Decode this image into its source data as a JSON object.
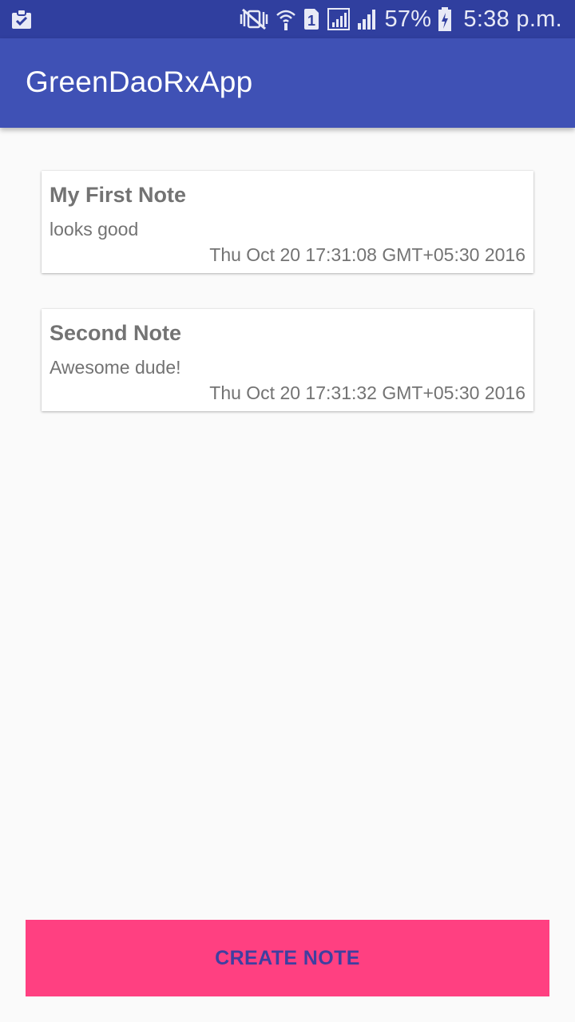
{
  "status_bar": {
    "left_icon": "clipboard-check-icon",
    "icons": [
      "mute-vibrate-icon",
      "wifi-icon",
      "sim-1-icon",
      "signal-1-icon",
      "signal-2-icon",
      "battery-charging-icon"
    ],
    "sim_label": "1",
    "battery_percent": "57%",
    "time": "5:38 p.m.",
    "color": "#303f9f"
  },
  "app_bar": {
    "title": "GreenDaoRxApp",
    "color": "#3f51b5"
  },
  "notes": [
    {
      "title": "My First Note",
      "body": "looks good",
      "date": "Thu Oct 20 17:31:08 GMT+05:30 2016"
    },
    {
      "title": "Second Note",
      "body": "Awesome dude!",
      "date": "Thu Oct 20 17:31:32 GMT+05:30 2016"
    }
  ],
  "create_button": {
    "label": "CREATE NOTE",
    "color": "#ff4081",
    "text_color": "#3f3fa0"
  }
}
